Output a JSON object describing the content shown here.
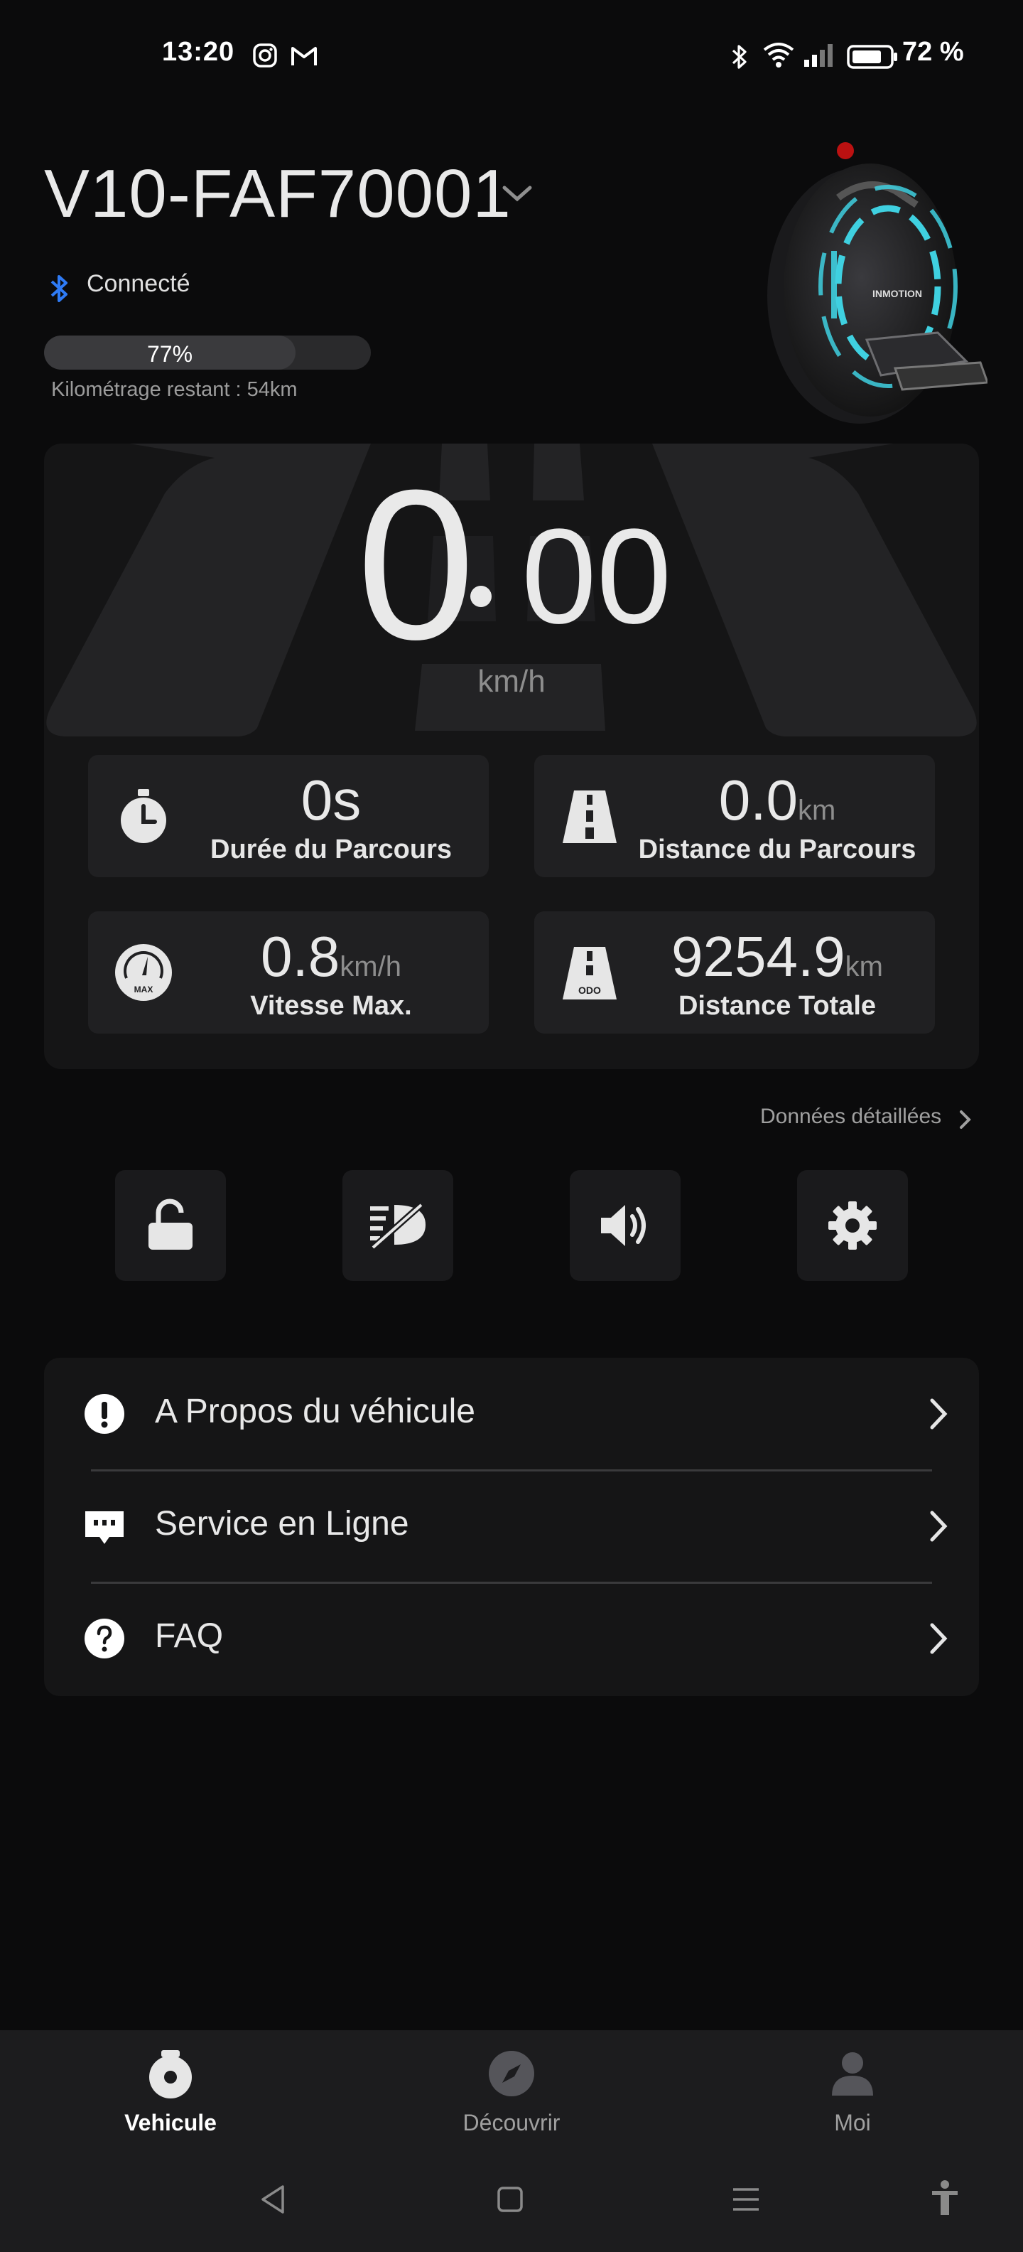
{
  "status_bar": {
    "time": "13:20",
    "battery_percent": "72 %",
    "icons": [
      "instagram-icon",
      "gmail-icon",
      "bluetooth-icon",
      "wifi-icon",
      "signal-icon",
      "battery-icon"
    ]
  },
  "header": {
    "vehicle_name": "V10-FAF70001",
    "connection_status": "Connecté",
    "battery_level_label": "77%",
    "battery_level": 0.77,
    "remaining_range": "Kilométrage restant : 54km"
  },
  "speed": {
    "integer": "0",
    "decimal": "00",
    "unit": "km/h"
  },
  "stats": [
    {
      "value": "0s",
      "unit": "",
      "label": "Durée du Parcours",
      "icon": "stopwatch-icon"
    },
    {
      "value": "0.0",
      "unit": "km",
      "label": "Distance du Parcours",
      "icon": "road-icon"
    },
    {
      "value": "0.8",
      "unit": "km/h",
      "label": "Vitesse Max.",
      "icon": "speedometer-max-icon",
      "icon_text": "MAX"
    },
    {
      "value": "9254.9",
      "unit": "km",
      "label": "Distance Totale",
      "icon": "odometer-road-icon",
      "icon_text": "ODO"
    }
  ],
  "detail_link": "Données détaillées",
  "controls": [
    {
      "name": "unlock-icon"
    },
    {
      "name": "headlight-off-icon"
    },
    {
      "name": "volume-icon"
    },
    {
      "name": "settings-gear-icon"
    }
  ],
  "menu": [
    {
      "label": "A Propos du véhicule",
      "icon": "info-alert-icon"
    },
    {
      "label": "Service en Ligne",
      "icon": "chat-bubble-icon"
    },
    {
      "label": "FAQ",
      "icon": "help-question-icon"
    }
  ],
  "bottom_nav": [
    {
      "label": "Vehicule",
      "active": true,
      "icon": "vehicle-wheel-icon"
    },
    {
      "label": "Découvrir",
      "active": false,
      "icon": "compass-icon"
    },
    {
      "label": "Moi",
      "active": false,
      "icon": "person-icon"
    }
  ],
  "colors": {
    "background": "#0b0b0c",
    "card": "#151516",
    "tile": "#202022",
    "bluetooth_accent": "#2f7bf5",
    "wheel_glow": "#3fd0e0"
  }
}
